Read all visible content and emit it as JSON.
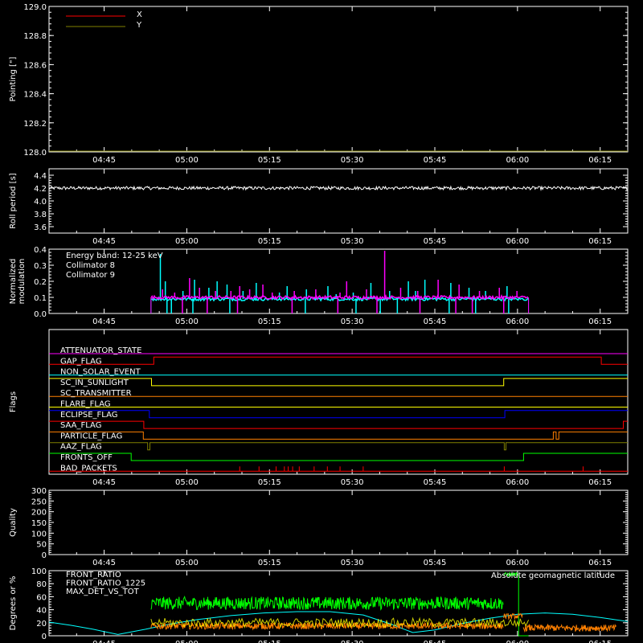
{
  "time_axis": {
    "start_minutes": 275,
    "end_minutes": 380,
    "ticks": [
      "04:45",
      "05:00",
      "05:15",
      "05:30",
      "05:45",
      "06:00",
      "06:15"
    ],
    "tick_minutes": [
      285,
      300,
      315,
      330,
      345,
      360,
      375
    ]
  },
  "chart_data": [
    {
      "type": "line",
      "ylabel": "Pointing [\"]",
      "ylim": [
        128.0,
        129.0
      ],
      "yticks": [
        "128.0",
        "128.2",
        "128.4",
        "128.6",
        "128.8",
        "129.0"
      ],
      "legend": [
        {
          "name": "X",
          "color": "#ff0000"
        },
        {
          "name": "Y",
          "color": "#808000"
        }
      ],
      "series": [
        {
          "name": "X",
          "color": "#ff0000",
          "x": [
            275,
            380
          ],
          "values": [
            128.0,
            128.0
          ]
        },
        {
          "name": "Y",
          "color": "#808000",
          "x": [
            275,
            380
          ],
          "values": [
            128.0,
            128.0
          ]
        }
      ]
    },
    {
      "type": "line",
      "ylabel": "Roll period [s]",
      "ylim": [
        3.5,
        4.5
      ],
      "yticks": [
        "3.6",
        "3.8",
        "4.0",
        "4.2",
        "4.4"
      ],
      "series": [
        {
          "color": "#ffffff",
          "x": [
            275,
            380
          ],
          "values": [
            4.2,
            4.2
          ]
        }
      ]
    },
    {
      "type": "line",
      "ylabel": "Normalized modulation",
      "ylim": [
        0.0,
        0.4
      ],
      "yticks": [
        "0.0",
        "0.1",
        "0.2",
        "0.3",
        "0.4"
      ],
      "annotation": "Energy band: 12-25 keV",
      "legend": [
        {
          "name": "Collimator 8",
          "color": "#00ffff"
        },
        {
          "name": "Collimator 9",
          "color": "#ff00ff"
        }
      ],
      "series": [
        {
          "name": "Collimator 8",
          "color": "#00ffff",
          "x_range": [
            293.5,
            362
          ],
          "baseline": 0.09,
          "spikes": [
            [
              295.2,
              0.37
            ],
            [
              296.1,
              0.2
            ],
            [
              299.3,
              0.14
            ],
            [
              301.4,
              0.21
            ],
            [
              304,
              0.16
            ],
            [
              305.5,
              0.2
            ],
            [
              307.3,
              0.18
            ],
            [
              310.2,
              0.14
            ],
            [
              312.6,
              0.19
            ],
            [
              316.8,
              0.13
            ],
            [
              318.2,
              0.17
            ],
            [
              321.7,
              0.15
            ],
            [
              325.6,
              0.17
            ],
            [
              327.1,
              0.12
            ],
            [
              330.2,
              0.13
            ],
            [
              333.4,
              0.19
            ],
            [
              336.8,
              0.14
            ],
            [
              340.2,
              0.2
            ],
            [
              341.5,
              0.14
            ],
            [
              343.2,
              0.21
            ],
            [
              347.9,
              0.19
            ],
            [
              351.2,
              0.16
            ],
            [
              354.2,
              0.14
            ],
            [
              358.1,
              0.17
            ]
          ],
          "dips": [
            296.4,
            297.2,
            301.1,
            307.8,
            321.5,
            330.7,
            335.1,
            338.2,
            347.6,
            352.4,
            358.4
          ]
        },
        {
          "name": "Collimator 9",
          "color": "#ff00ff",
          "x_range": [
            293.5,
            362
          ],
          "baseline": 0.1,
          "spikes": [
            [
              295.6,
              0.15
            ],
            [
              297.8,
              0.13
            ],
            [
              300.5,
              0.22
            ],
            [
              302.3,
              0.16
            ],
            [
              305.2,
              0.14
            ],
            [
              308,
              0.14
            ],
            [
              309.6,
              0.17
            ],
            [
              311.4,
              0.15
            ],
            [
              313.8,
              0.18
            ],
            [
              315.5,
              0.13
            ],
            [
              319.5,
              0.14
            ],
            [
              323.4,
              0.15
            ],
            [
              327.8,
              0.13
            ],
            [
              329,
              0.2
            ],
            [
              332.6,
              0.15
            ],
            [
              335.9,
              0.39
            ],
            [
              338.8,
              0.16
            ],
            [
              341.9,
              0.14
            ],
            [
              345.6,
              0.21
            ],
            [
              349.4,
              0.18
            ],
            [
              353.1,
              0.14
            ],
            [
              356.7,
              0.16
            ],
            [
              359.9,
              0.14
            ]
          ],
          "dips": [
            299.2,
            303.7,
            309.2,
            319.1,
            327.4,
            334.5,
            342.3,
            348.8,
            351.8,
            357.5
          ]
        }
      ]
    },
    {
      "type": "line",
      "ylabel": "Flags",
      "series": [
        {
          "name": "ATTENUATOR_STATE",
          "color": "#ff00ff",
          "levels": [
            [
              275,
              0
            ]
          ]
        },
        {
          "name": "GAP_FLAG",
          "color": "#ff0000",
          "levels": [
            [
              275,
              0
            ],
            [
              294,
              1
            ],
            [
              375.2,
              0
            ]
          ]
        },
        {
          "name": "NON_SOLAR_EVENT",
          "color": "#00ffff",
          "levels": [
            [
              275,
              0
            ]
          ]
        },
        {
          "name": "SC_IN_SUNLIGHT",
          "color": "#ffff00",
          "levels": [
            [
              275,
              1
            ],
            [
              293.6,
              0
            ],
            [
              357.5,
              1
            ]
          ]
        },
        {
          "name": "SC_TRANSMITTER",
          "color": "#ff8000",
          "levels": [
            [
              275,
              0
            ]
          ]
        },
        {
          "name": "FLARE_FLAG",
          "color": "#ffff00",
          "levels": [
            [
              275,
              0
            ]
          ]
        },
        {
          "name": "ECLIPSE_FLAG",
          "color": "#0000ff",
          "levels": [
            [
              275,
              1
            ],
            [
              293.2,
              0
            ],
            [
              357.7,
              1
            ]
          ]
        },
        {
          "name": "SAA_FLAG",
          "color": "#ff0000",
          "levels": [
            [
              275,
              1
            ],
            [
              292.2,
              0
            ],
            [
              379.2,
              1
            ]
          ]
        },
        {
          "name": "PARTICLE_FLAG",
          "color": "#ff8000",
          "levels": [
            [
              275,
              1
            ],
            [
              292.1,
              0
            ],
            [
              366.5,
              1
            ],
            [
              367,
              0
            ],
            [
              367.5,
              1
            ]
          ]
        },
        {
          "name": "AAZ_FLAG",
          "color": "#808000",
          "levels": [
            [
              275,
              1
            ],
            [
              292.9,
              0
            ],
            [
              293.3,
              1
            ],
            [
              357.6,
              0
            ],
            [
              357.9,
              1
            ]
          ]
        },
        {
          "name": "FRONTS_OFF",
          "color": "#00ff00",
          "levels": [
            [
              275,
              1
            ],
            [
              289.9,
              0
            ],
            [
              361.1,
              1
            ]
          ]
        },
        {
          "name": "BAD_PACKETS",
          "color": "#ff0000",
          "levels": [
            [
              275,
              0
            ]
          ],
          "ticks": [
            309.6,
            313.1,
            316.2,
            317.7,
            318.4,
            319.2,
            320.4,
            323.1,
            325.5,
            327.8,
            332.0,
            357.6,
            371.9
          ]
        }
      ]
    },
    {
      "type": "line",
      "ylabel": "Quality",
      "ylim": [
        0,
        300
      ],
      "yticks": [
        "0",
        "50",
        "100",
        "150",
        "200",
        "250",
        "300"
      ],
      "series": []
    },
    {
      "type": "line",
      "ylabel": "Degrees or %",
      "ylim": [
        0,
        100
      ],
      "yticks": [
        "0",
        "20",
        "40",
        "60",
        "80",
        "100"
      ],
      "legend": [
        {
          "name": "FRONT_RATIO",
          "color": "#ffff00"
        },
        {
          "name": "FRONT_RATIO_1225",
          "color": "#00ff00"
        },
        {
          "name": "MAX_DET_VS_TOT",
          "color": "#ff8000"
        }
      ],
      "annotation": {
        "text": "Absolute geomagnetic latitude",
        "color": "#00ffff"
      },
      "series": [
        {
          "name": "Absolute geomagnetic latitude",
          "color": "#00ffff",
          "x": [
            275,
            279,
            283,
            287.5,
            290,
            292.5,
            297,
            302,
            308,
            314,
            320,
            326,
            332,
            337,
            341,
            345,
            350,
            355,
            360,
            365,
            370,
            375,
            380
          ],
          "values": [
            21,
            16,
            10,
            2,
            6,
            10,
            18,
            25,
            31,
            35,
            37,
            37,
            32,
            18,
            5,
            9,
            19,
            27,
            33,
            35,
            33,
            28,
            22
          ]
        },
        {
          "name": "FRONT_RATIO_1225",
          "color": "#00ff00",
          "x_range": [
            293.5,
            362
          ],
          "segments": [
            {
              "from": 293.5,
              "to": 357.5,
              "mean": 50,
              "noise": 10
            },
            {
              "from": 357.5,
              "to": 360.2,
              "mean": 94,
              "noise": 3
            }
          ],
          "drop": [
            360.2,
            360.8,
            0
          ]
        },
        {
          "name": "MAX_DET_VS_TOT",
          "color": "#ff8000",
          "x_range": [
            293.5,
            380
          ],
          "segments": [
            {
              "from": 293.5,
              "to": 357.5,
              "mean": 15,
              "noise": 5
            },
            {
              "from": 357.5,
              "to": 361,
              "mean": 30,
              "noise": 4
            },
            {
              "from": 361,
              "to": 378,
              "mean": 12,
              "noise": 5
            }
          ]
        },
        {
          "name": "FRONT_RATIO",
          "color": "#ffff00",
          "x_range": [
            293.5,
            362
          ],
          "mean": 20,
          "noise": 7
        }
      ]
    }
  ]
}
